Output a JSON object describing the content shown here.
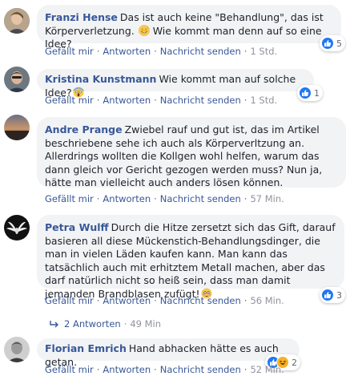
{
  "actions": {
    "like": "Gefällt mir",
    "reply": "Antworten",
    "message": "Nachricht senden",
    "separator": "·"
  },
  "comments": [
    {
      "author": "Franzi Hense",
      "text": "Das ist auch keine \"Behandlung\", das ist Körperverletzung.",
      "text_after_emoji": " Wie kommt man denn auf so eine Idee?",
      "emoji": "grin-sweat-emoji",
      "time": "1 Std.",
      "reactions": [
        "like-icon"
      ],
      "reaction_count": "5"
    },
    {
      "author": "Kristina Kunstmann",
      "text": "Wie kommt man auf solche Idee?",
      "emoji": "scream-emoji",
      "time": "1 Std.",
      "reactions": [
        "like-icon"
      ],
      "reaction_count": "1"
    },
    {
      "author": "Andre Prange",
      "text": "Zwiebel rauf und gut ist, das im Artikel beschriebene sehe ich auch als Körperverltzung an. Allerdrings wollten die Kollgen wohl helfen, warum das dann gleich vor Gericht gezogen werden muss? Nun ja, hätte man vielleicht auch anders lösen können.",
      "time": "57 Min."
    },
    {
      "author": "Petra Wulff",
      "text": "Durch die Hitze zersetzt sich das Gift, darauf basieren all diese Mückenstich-Behandlungsdinger, die man in vielen Läden kaufen kann. Man kann das tatsächlich auch mit erhitztem Metall machen, aber das darf natürlich nicht so heiß sein, dass man damit jemanden Brandblasen zufügt!",
      "emoji": "flushed-emoji",
      "time": "56 Min.",
      "reactions": [
        "like-icon"
      ],
      "reaction_count": "3",
      "replies": {
        "label": "2 Antworten",
        "time": "49 Min"
      }
    },
    {
      "author": "Florian Emrich",
      "text": "Hand abhacken hätte es auch getan.",
      "time": "52 Min.",
      "reactions": [
        "like-icon",
        "haha-icon"
      ],
      "reaction_count": "2"
    }
  ],
  "colors": {
    "author": "#385898",
    "bubble": "#f2f3f5",
    "like": "#2078f4",
    "haha": "#f7b125",
    "meta": "#90949c"
  }
}
